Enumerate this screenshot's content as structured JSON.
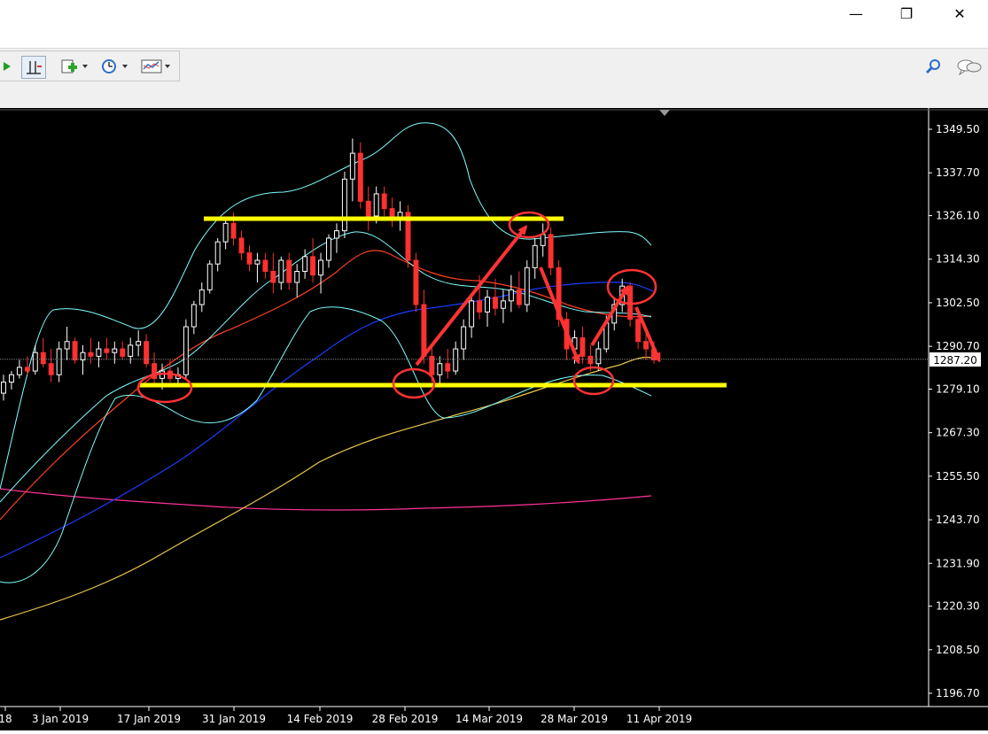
{
  "window": {
    "minimize_glyph": "—",
    "restore_glyph": "❐",
    "close_glyph": "✕"
  },
  "mdi": {
    "minimize_glyph": "‗",
    "restore_glyph": "❐",
    "close_glyph": "✕"
  },
  "toolbar": {
    "icons": [
      "play-green-icon",
      "crosshair-icon",
      "add-indicator-icon",
      "clock-icon",
      "chart-template-icon"
    ],
    "right_icons": [
      "search-icon",
      "chat-icon"
    ]
  },
  "chart": {
    "price_axis": [
      "1349.50",
      "1337.70",
      "1326.10",
      "1314.30",
      "1302.50",
      "1290.70",
      "1279.10",
      "1267.30",
      "1255.50",
      "1243.70",
      "1231.90",
      "1220.30",
      "1208.50",
      "1196.70"
    ],
    "current_price": "1287.20",
    "date_axis": [
      {
        "label": "18"
      },
      {
        "label": "3 Jan 2019"
      },
      {
        "label": "17 Jan 2019"
      },
      {
        "label": "31 Jan 2019"
      },
      {
        "label": "14 Feb 2019"
      },
      {
        "label": "28 Feb 2019"
      },
      {
        "label": "14 Mar 2019"
      },
      {
        "label": "28 Mar 2019"
      },
      {
        "label": "11 Apr 2019"
      }
    ],
    "colors": {
      "background": "#000000",
      "bull": "#ffffff",
      "bear": "#ff3030",
      "support_resistance": "#ffff00",
      "annotation": "#ff3333",
      "bollinger": "#7fffff",
      "ma_fast": "#1a3cff",
      "ma_mid": "#ff4020",
      "ma_slow": "#e8c84a",
      "ma_long": "#ff3399",
      "grid_text": "#ffffff"
    }
  },
  "chart_data": {
    "type": "candlestick",
    "x_range": [
      "2018-12-24",
      "2019-04-15"
    ],
    "y_range": [
      1196.7,
      1349.5
    ],
    "resistance_level": 1325.5,
    "support_level": 1280.0,
    "candles": [
      {
        "o": 1278,
        "h": 1283,
        "l": 1276,
        "c": 1281
      },
      {
        "o": 1281,
        "h": 1284,
        "l": 1279,
        "c": 1283
      },
      {
        "o": 1283,
        "h": 1287,
        "l": 1282,
        "c": 1285
      },
      {
        "o": 1285,
        "h": 1288,
        "l": 1283,
        "c": 1284
      },
      {
        "o": 1284,
        "h": 1291,
        "l": 1283,
        "c": 1289
      },
      {
        "o": 1289,
        "h": 1293,
        "l": 1285,
        "c": 1286
      },
      {
        "o": 1286,
        "h": 1290,
        "l": 1281,
        "c": 1283
      },
      {
        "o": 1283,
        "h": 1292,
        "l": 1281,
        "c": 1290
      },
      {
        "o": 1290,
        "h": 1296,
        "l": 1287,
        "c": 1292
      },
      {
        "o": 1292,
        "h": 1293,
        "l": 1286,
        "c": 1287
      },
      {
        "o": 1287,
        "h": 1291,
        "l": 1283,
        "c": 1289
      },
      {
        "o": 1289,
        "h": 1293,
        "l": 1286,
        "c": 1288
      },
      {
        "o": 1288,
        "h": 1292,
        "l": 1285,
        "c": 1290
      },
      {
        "o": 1290,
        "h": 1293,
        "l": 1287,
        "c": 1289
      },
      {
        "o": 1289,
        "h": 1292,
        "l": 1286,
        "c": 1290
      },
      {
        "o": 1290,
        "h": 1292,
        "l": 1287,
        "c": 1288
      },
      {
        "o": 1288,
        "h": 1293,
        "l": 1286,
        "c": 1291
      },
      {
        "o": 1291,
        "h": 1295,
        "l": 1288,
        "c": 1292
      },
      {
        "o": 1292,
        "h": 1294,
        "l": 1285,
        "c": 1286
      },
      {
        "o": 1286,
        "h": 1289,
        "l": 1280,
        "c": 1282
      },
      {
        "o": 1282,
        "h": 1286,
        "l": 1279,
        "c": 1284
      },
      {
        "o": 1284,
        "h": 1287,
        "l": 1281,
        "c": 1282
      },
      {
        "o": 1282,
        "h": 1285,
        "l": 1280,
        "c": 1283
      },
      {
        "o": 1283,
        "h": 1298,
        "l": 1282,
        "c": 1296
      },
      {
        "o": 1296,
        "h": 1303,
        "l": 1294,
        "c": 1302
      },
      {
        "o": 1302,
        "h": 1308,
        "l": 1300,
        "c": 1306
      },
      {
        "o": 1306,
        "h": 1314,
        "l": 1305,
        "c": 1313
      },
      {
        "o": 1313,
        "h": 1320,
        "l": 1311,
        "c": 1319
      },
      {
        "o": 1319,
        "h": 1325,
        "l": 1317,
        "c": 1324
      },
      {
        "o": 1324,
        "h": 1327,
        "l": 1318,
        "c": 1320
      },
      {
        "o": 1320,
        "h": 1322,
        "l": 1314,
        "c": 1316
      },
      {
        "o": 1316,
        "h": 1318,
        "l": 1311,
        "c": 1313
      },
      {
        "o": 1313,
        "h": 1316,
        "l": 1308,
        "c": 1314
      },
      {
        "o": 1314,
        "h": 1316,
        "l": 1309,
        "c": 1311
      },
      {
        "o": 1311,
        "h": 1316,
        "l": 1305,
        "c": 1308
      },
      {
        "o": 1308,
        "h": 1315,
        "l": 1306,
        "c": 1314
      },
      {
        "o": 1314,
        "h": 1316,
        "l": 1306,
        "c": 1308
      },
      {
        "o": 1308,
        "h": 1313,
        "l": 1304,
        "c": 1311
      },
      {
        "o": 1311,
        "h": 1317,
        "l": 1309,
        "c": 1315
      },
      {
        "o": 1315,
        "h": 1320,
        "l": 1308,
        "c": 1310
      },
      {
        "o": 1310,
        "h": 1316,
        "l": 1305,
        "c": 1314
      },
      {
        "o": 1314,
        "h": 1321,
        "l": 1312,
        "c": 1320
      },
      {
        "o": 1320,
        "h": 1324,
        "l": 1316,
        "c": 1322
      },
      {
        "o": 1322,
        "h": 1338,
        "l": 1320,
        "c": 1336
      },
      {
        "o": 1336,
        "h": 1347,
        "l": 1330,
        "c": 1343
      },
      {
        "o": 1343,
        "h": 1346,
        "l": 1328,
        "c": 1330
      },
      {
        "o": 1330,
        "h": 1334,
        "l": 1322,
        "c": 1326
      },
      {
        "o": 1326,
        "h": 1334,
        "l": 1324,
        "c": 1332
      },
      {
        "o": 1332,
        "h": 1334,
        "l": 1326,
        "c": 1328
      },
      {
        "o": 1328,
        "h": 1331,
        "l": 1323,
        "c": 1325
      },
      {
        "o": 1325,
        "h": 1330,
        "l": 1322,
        "c": 1327
      },
      {
        "o": 1327,
        "h": 1329,
        "l": 1312,
        "c": 1314
      },
      {
        "o": 1314,
        "h": 1316,
        "l": 1300,
        "c": 1302
      },
      {
        "o": 1302,
        "h": 1306,
        "l": 1286,
        "c": 1288
      },
      {
        "o": 1288,
        "h": 1291,
        "l": 1281,
        "c": 1283
      },
      {
        "o": 1283,
        "h": 1288,
        "l": 1280,
        "c": 1286
      },
      {
        "o": 1286,
        "h": 1290,
        "l": 1282,
        "c": 1284
      },
      {
        "o": 1284,
        "h": 1292,
        "l": 1283,
        "c": 1290
      },
      {
        "o": 1290,
        "h": 1298,
        "l": 1287,
        "c": 1296
      },
      {
        "o": 1296,
        "h": 1305,
        "l": 1293,
        "c": 1303
      },
      {
        "o": 1303,
        "h": 1310,
        "l": 1298,
        "c": 1300
      },
      {
        "o": 1300,
        "h": 1306,
        "l": 1296,
        "c": 1304
      },
      {
        "o": 1304,
        "h": 1309,
        "l": 1299,
        "c": 1301
      },
      {
        "o": 1301,
        "h": 1306,
        "l": 1297,
        "c": 1303
      },
      {
        "o": 1303,
        "h": 1310,
        "l": 1300,
        "c": 1306
      },
      {
        "o": 1306,
        "h": 1311,
        "l": 1301,
        "c": 1302
      },
      {
        "o": 1302,
        "h": 1314,
        "l": 1300,
        "c": 1312
      },
      {
        "o": 1312,
        "h": 1320,
        "l": 1309,
        "c": 1318
      },
      {
        "o": 1318,
        "h": 1324,
        "l": 1315,
        "c": 1321
      },
      {
        "o": 1321,
        "h": 1323,
        "l": 1310,
        "c": 1312
      },
      {
        "o": 1312,
        "h": 1314,
        "l": 1296,
        "c": 1298
      },
      {
        "o": 1298,
        "h": 1300,
        "l": 1287,
        "c": 1290
      },
      {
        "o": 1290,
        "h": 1295,
        "l": 1286,
        "c": 1293
      },
      {
        "o": 1293,
        "h": 1296,
        "l": 1286,
        "c": 1288
      },
      {
        "o": 1288,
        "h": 1291,
        "l": 1284,
        "c": 1286
      },
      {
        "o": 1286,
        "h": 1292,
        "l": 1284,
        "c": 1290
      },
      {
        "o": 1290,
        "h": 1299,
        "l": 1289,
        "c": 1297
      },
      {
        "o": 1297,
        "h": 1304,
        "l": 1295,
        "c": 1302
      },
      {
        "o": 1302,
        "h": 1309,
        "l": 1300,
        "c": 1307
      },
      {
        "o": 1307,
        "h": 1308,
        "l": 1296,
        "c": 1298
      },
      {
        "o": 1298,
        "h": 1299,
        "l": 1290,
        "c": 1292
      },
      {
        "o": 1292,
        "h": 1294,
        "l": 1287,
        "c": 1290
      },
      {
        "o": 1290,
        "h": 1292,
        "l": 1286,
        "c": 1287
      }
    ]
  }
}
